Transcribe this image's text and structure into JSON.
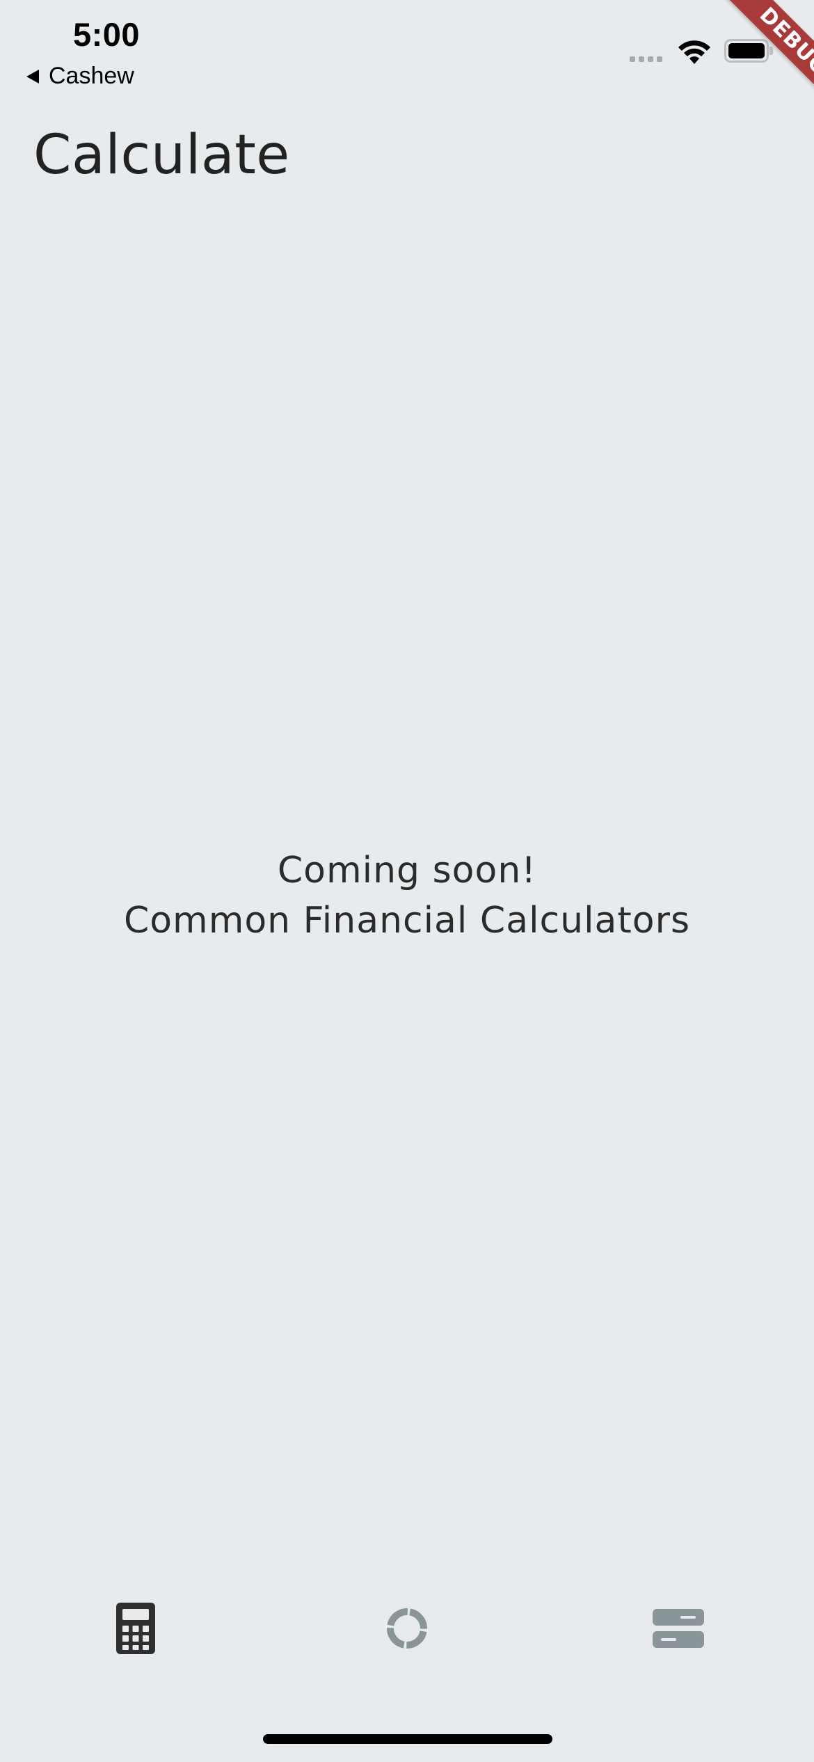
{
  "status_bar": {
    "time": "5:00",
    "back_app": "Cashew"
  },
  "debug_banner": {
    "label": "DEBUG"
  },
  "header": {
    "title": "Calculate"
  },
  "main": {
    "message_line1": "Coming soon!",
    "message_line2": "Common Financial Calculators"
  },
  "bottom_nav": {
    "items": [
      {
        "icon": "calculator-icon",
        "active": true
      },
      {
        "icon": "budget-ring-icon",
        "active": false
      },
      {
        "icon": "more-list-icon",
        "active": false
      }
    ]
  },
  "colors": {
    "background": "#e8ebed",
    "active_icon": "#2f2f2f",
    "inactive_icon": "#8a9599",
    "debug_banner": "#a83a3a"
  }
}
